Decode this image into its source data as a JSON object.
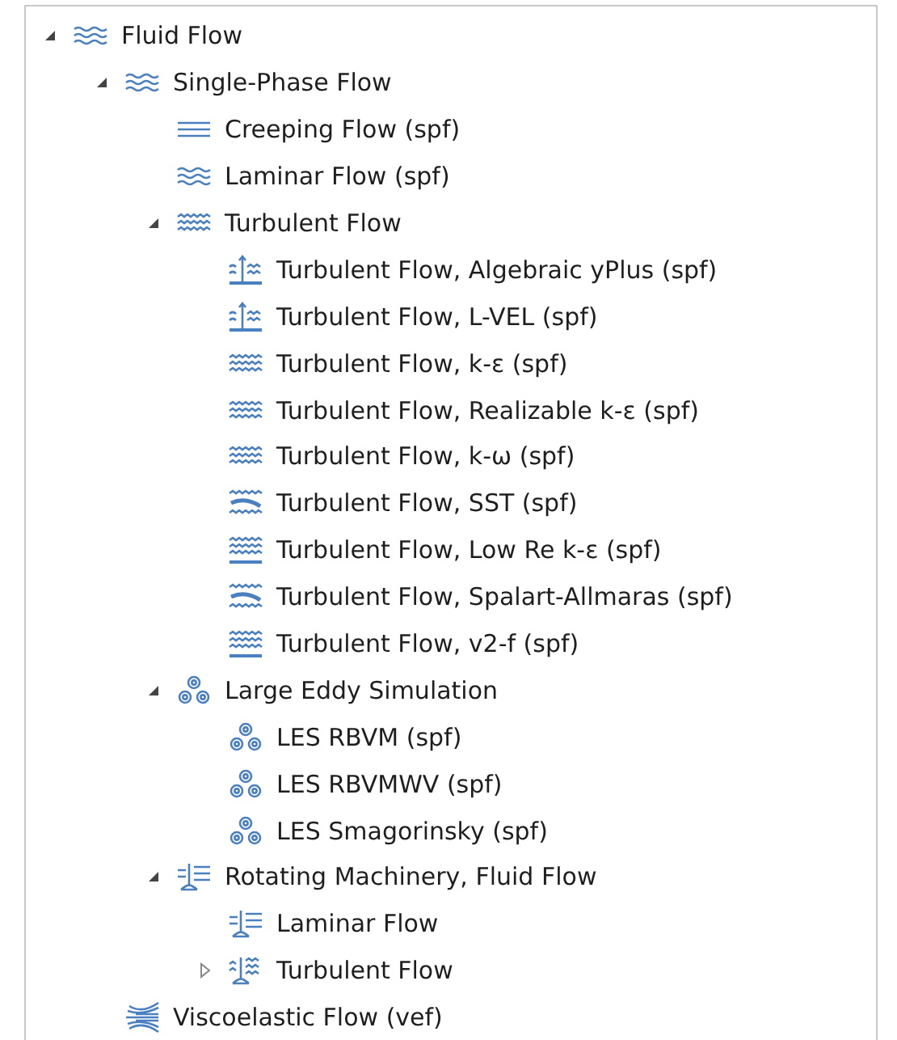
{
  "tree": [
    {
      "label": "Fluid Flow",
      "kind": "waves",
      "expanded": true,
      "children": [
        {
          "label": "Single-Phase Flow",
          "kind": "waves",
          "expanded": true,
          "children": [
            {
              "label": "Creeping Flow (spf)",
              "kind": "creeping"
            },
            {
              "label": "Laminar Flow (spf)",
              "kind": "waves"
            },
            {
              "label": "Turbulent Flow",
              "kind": "turbulent",
              "expanded": true,
              "children": [
                {
                  "label": "Turbulent Flow, Algebraic yPlus (spf)",
                  "kind": "wall"
                },
                {
                  "label": "Turbulent Flow, L-VEL (spf)",
                  "kind": "wall"
                },
                {
                  "label": "Turbulent Flow, k-ε (spf)",
                  "kind": "turbulent"
                },
                {
                  "label": "Turbulent Flow, Realizable k-ε (spf)",
                  "kind": "turbulent"
                },
                {
                  "label": "Turbulent Flow, k-ω (spf)",
                  "kind": "turbulent"
                },
                {
                  "label": "Turbulent Flow, SST (spf)",
                  "kind": "sst"
                },
                {
                  "label": "Turbulent Flow, Low Re k-ε (spf)",
                  "kind": "lowre"
                },
                {
                  "label": "Turbulent Flow, Spalart-Allmaras (spf)",
                  "kind": "sst"
                },
                {
                  "label": "Turbulent Flow, v2-f (spf)",
                  "kind": "lowre"
                }
              ]
            },
            {
              "label": "Large Eddy Simulation",
              "kind": "eddy",
              "expanded": true,
              "children": [
                {
                  "label": "LES RBVM (spf)",
                  "kind": "eddy"
                },
                {
                  "label": "LES RBVMWV (spf)",
                  "kind": "eddy"
                },
                {
                  "label": "LES Smagorinsky (spf)",
                  "kind": "eddy"
                }
              ]
            },
            {
              "label": "Rotating Machinery, Fluid Flow",
              "kind": "rotlam",
              "expanded": true,
              "children": [
                {
                  "label": "Laminar Flow",
                  "kind": "rotlam"
                },
                {
                  "label": "Turbulent Flow",
                  "kind": "rotturb",
                  "expanded": false
                }
              ]
            }
          ]
        },
        {
          "label": "Viscoelastic Flow (vef)",
          "kind": "visco"
        }
      ]
    }
  ]
}
